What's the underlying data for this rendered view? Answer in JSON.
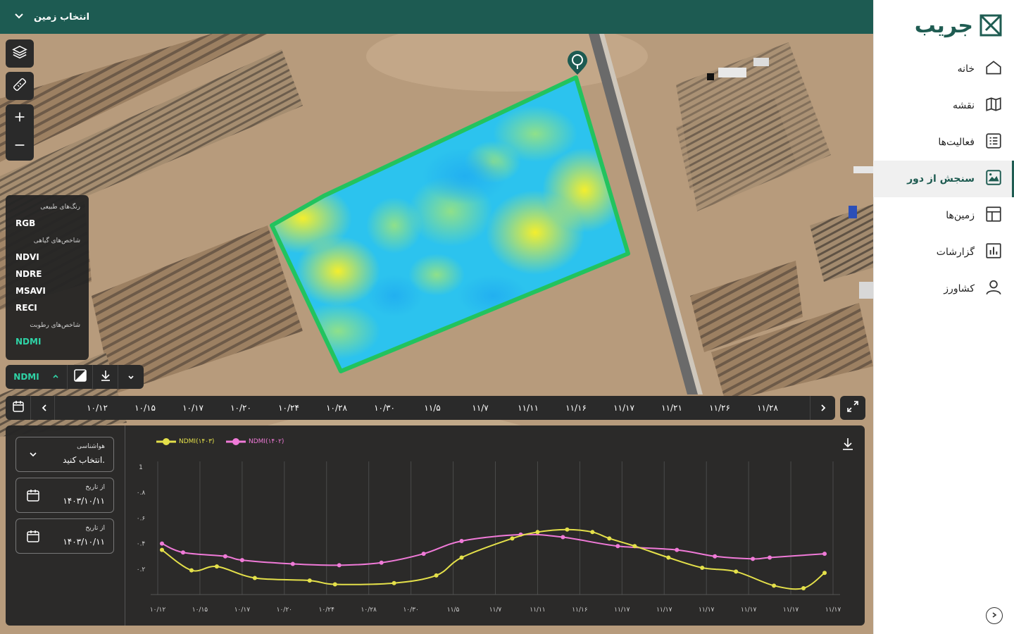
{
  "sidebar": {
    "brand": "جریب",
    "items": [
      {
        "label": "خانه",
        "icon": "home-icon"
      },
      {
        "label": "نقشه",
        "icon": "map-icon"
      },
      {
        "label": "فعالیت‌ها",
        "icon": "activities-icon"
      },
      {
        "label": "سنجش از دور",
        "icon": "remote-sensing-icon",
        "active": true
      },
      {
        "label": "زمین‌ها",
        "icon": "lands-icon"
      },
      {
        "label": "گزارشات",
        "icon": "reports-icon"
      },
      {
        "label": "کشاورز",
        "icon": "farmer-icon"
      }
    ]
  },
  "topbar": {
    "land_select_label": "انتخاب زمین"
  },
  "index_panel": {
    "group_natural": "رنگ‌های طبیعی",
    "rgb": "RGB",
    "group_vegetation": "شاخص‌های گیاهی",
    "ndvi": "NDVI",
    "ndre": "NDRE",
    "msavi": "MSAVI",
    "reci": "RECI",
    "group_moisture": "شاخص‌های رطوبت",
    "ndmi": "NDMI"
  },
  "index_bar": {
    "current": "NDMI"
  },
  "timeline": {
    "dates": [
      "۱۰/۱۲",
      "۱۰/۱۵",
      "۱۰/۱۷",
      "۱۰/۲۰",
      "۱۰/۲۴",
      "۱۰/۲۸",
      "۱۰/۳۰",
      "۱۱/۵",
      "۱۱/۷",
      "۱۱/۱۱",
      "۱۱/۱۶",
      "۱۱/۱۷",
      "۱۱/۲۱",
      "۱۱/۲۶",
      "۱۱/۲۸"
    ]
  },
  "chart_controls": {
    "weather_label": "هواشناسی",
    "weather_value": "انتخاب کنید.",
    "from_label_1": "از تاریخ",
    "from_value_1": "۱۴۰۳/۱۰/۱۱",
    "from_label_2": "از تاریخ",
    "from_value_2": "۱۴۰۳/۱۰/۱۱"
  },
  "colors": {
    "brand": "#1d5b52",
    "series_1403": "#e4e04a",
    "series_1402": "#f07ad8",
    "selected_index": "#2fd3a6"
  },
  "chart_data": {
    "type": "line",
    "yticks": [
      "1",
      "۰.۸",
      "۰.۶",
      "۰.۴",
      "۰.۲"
    ],
    "ylim": [
      0,
      1
    ],
    "xticks": [
      "۱۰/۱۲",
      "۱۰/۱۵",
      "۱۰/۱۷",
      "۱۰/۲۰",
      "۱۰/۲۴",
      "۱۰/۲۸",
      "۱۰/۳۰",
      "۱۱/۵",
      "۱۱/۷",
      "۱۱/۱۱",
      "۱۱/۱۶",
      "۱۱/۱۷",
      "۱۱/۱۷",
      "۱۱/۱۷",
      "۱۱/۱۷",
      "۱۱/۱۷",
      "۱۱/۱۷"
    ],
    "series": [
      {
        "name": "NDMI(۱۴۰۳)",
        "color": "#e4e04a",
        "x": [
          0.1,
          0.8,
          1.4,
          2.3,
          3.6,
          4.2,
          5.6,
          6.6,
          7.2,
          8.4,
          9.0,
          9.7,
          10.3,
          10.7,
          11.3,
          12.1,
          12.9,
          13.7,
          14.6,
          15.3,
          15.8
        ],
        "y": [
          0.35,
          0.19,
          0.22,
          0.13,
          0.11,
          0.08,
          0.09,
          0.15,
          0.29,
          0.44,
          0.49,
          0.51,
          0.49,
          0.44,
          0.38,
          0.29,
          0.21,
          0.18,
          0.07,
          0.05,
          0.17
        ]
      },
      {
        "name": "NDMI(۱۴۰۲)",
        "color": "#f07ad8",
        "x": [
          0.1,
          0.6,
          1.6,
          2.0,
          3.2,
          4.3,
          5.3,
          6.3,
          7.2,
          8.6,
          9.6,
          10.9,
          12.3,
          13.2,
          14.1,
          14.5,
          15.8
        ],
        "y": [
          0.4,
          0.33,
          0.3,
          0.27,
          0.24,
          0.23,
          0.25,
          0.32,
          0.42,
          0.47,
          0.45,
          0.38,
          0.35,
          0.3,
          0.28,
          0.29,
          0.32
        ]
      }
    ]
  }
}
